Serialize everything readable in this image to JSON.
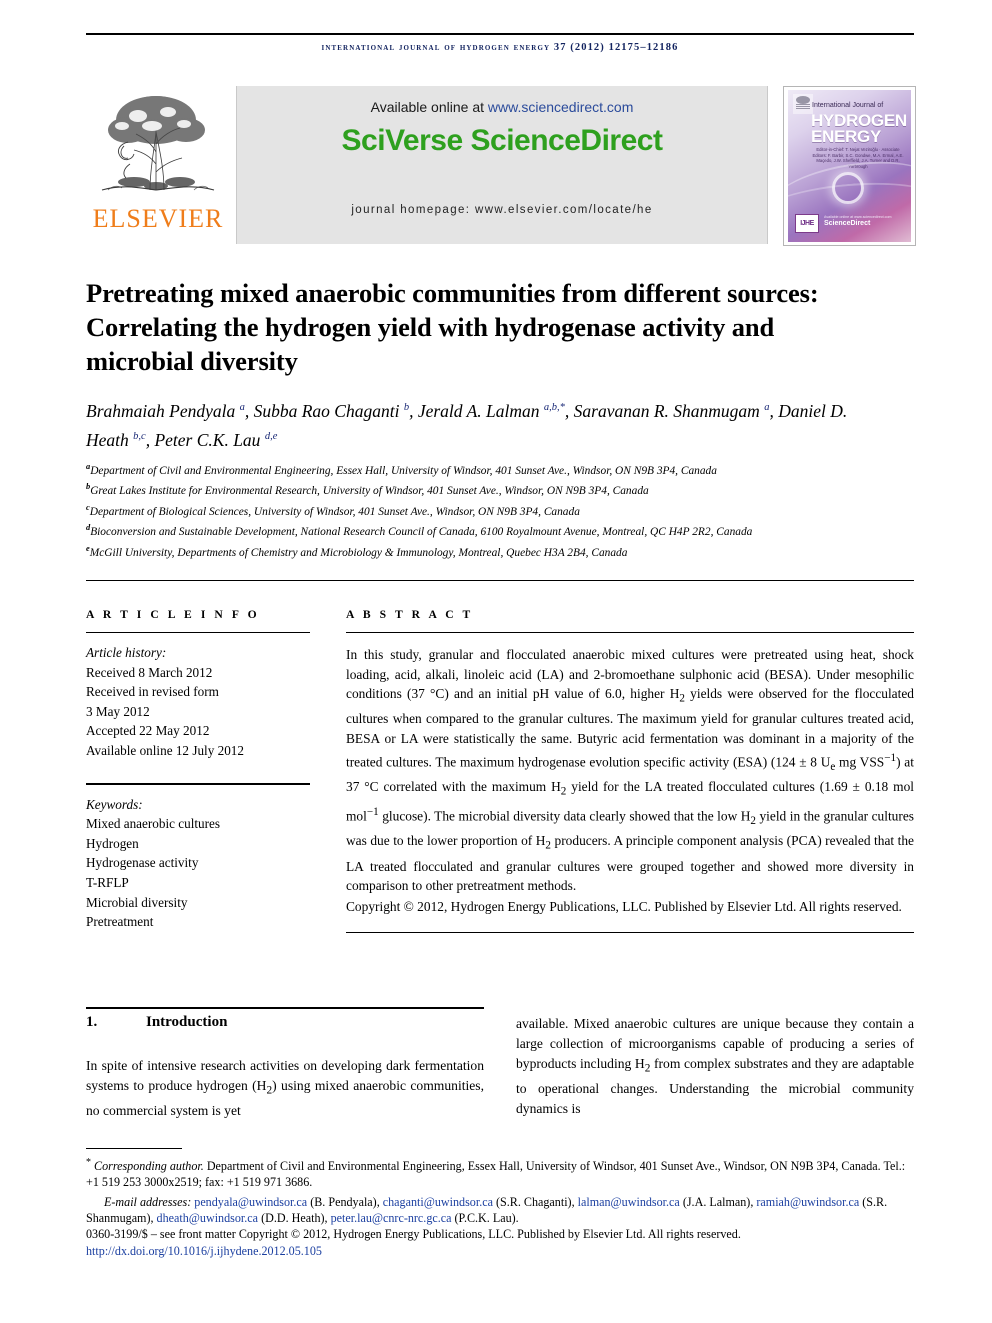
{
  "running_head": "international journal of hydrogen energy 37 (2012) 12175–12186",
  "masthead": {
    "publisher_name": "ELSEVIER",
    "available_prefix": "Available online at ",
    "available_link": "www.sciencedirect.com",
    "sciencedirect_logo": "SciVerse ScienceDirect",
    "journal_homepage": "journal homepage: www.elsevier.com/locate/he",
    "cover": {
      "line1": "International Journal of",
      "line2": "HYDROGEN",
      "line3": "ENERGY",
      "editors": "Editor-in-Chief: T. Nejat Veziroğlu · Associate Editors: F. Barbir, S.C. Gondwe, M.A. Ermal, A.E. Maçedo, J.W. Sheffield, J.A. Turner and D.R. Yarbrough",
      "badge": "IJHE",
      "sciencedirect_mark": "ScienceDirect",
      "sciencedirect_mark_top": "Available online at www.sciencedirect.com"
    }
  },
  "title": "Pretreating mixed anaerobic communities from different sources: Correlating the hydrogen yield with hydrogenase activity and microbial diversity",
  "authors_html": "Brahmaiah Pendyala <sup>a</sup>, Subba Rao Chaganti <sup>b</sup>, Jerald A. Lalman <sup>a,b,*</sup>, Saravanan R. Shanmugam <sup>a</sup>, Daniel D. Heath <sup>b,c</sup>, Peter C.K. Lau <sup>d,e</sup>",
  "affiliations": [
    {
      "mark": "a",
      "text": "Department of Civil and Environmental Engineering, Essex Hall, University of Windsor, 401 Sunset Ave., Windsor, ON N9B 3P4, Canada"
    },
    {
      "mark": "b",
      "text": "Great Lakes Institute for Environmental Research, University of Windsor, 401 Sunset Ave., Windsor, ON N9B 3P4, Canada"
    },
    {
      "mark": "c",
      "text": "Department of Biological Sciences, University of Windsor, 401 Sunset Ave., Windsor, ON N9B 3P4, Canada"
    },
    {
      "mark": "d",
      "text": "Bioconversion and Sustainable Development, National Research Council of Canada, 6100 Royalmount Avenue, Montreal, QC H4P 2R2, Canada"
    },
    {
      "mark": "e",
      "text": "McGill University, Departments of Chemistry and Microbiology & Immunology, Montreal, Quebec H3A 2B4, Canada"
    }
  ],
  "article_info": {
    "heading": "A R T I C L E   I N F O",
    "history_label": "Article history:",
    "history": [
      "Received 8 March 2012",
      "Received in revised form",
      "3 May 2012",
      "Accepted 22 May 2012",
      "Available online 12 July 2012"
    ],
    "keywords_label": "Keywords:",
    "keywords": [
      "Mixed anaerobic cultures",
      "Hydrogen",
      "Hydrogenase activity",
      "T-RFLP",
      "Microbial diversity",
      "Pretreatment"
    ]
  },
  "abstract": {
    "heading": "A B S T R A C T",
    "body_html": "In this study, granular and flocculated anaerobic mixed cultures were pretreated using heat, shock loading, acid, alkali, linoleic acid (LA) and 2-bromoethane sulphonic acid (BESA). Under mesophilic conditions (37&nbsp;&deg;C) and an initial pH value of 6.0, higher H<sub>2</sub> yields were observed for the flocculated cultures when compared to the granular cultures. The maximum yield for granular cultures treated acid, BESA or LA were statistically the same. Butyric acid fermentation was dominant in a majority of the treated cultures. The maximum hydrogenase evolution specific activity (ESA) (124&nbsp;&plusmn;&nbsp;8 U<sub>e</sub> mg VSS<sup>&minus;1</sup>) at 37&nbsp;&deg;C correlated with the maximum H<sub>2</sub> yield for the LA treated flocculated cultures (1.69&nbsp;&plusmn;&nbsp;0.18 mol mol<sup>&minus;1</sup> glucose). The microbial diversity data clearly showed that the low H<sub>2</sub> yield in the granular cultures was due to the lower proportion of H<sub>2</sub> producers. A principle component analysis (PCA) revealed that the LA treated flocculated and granular cultures were grouped together and showed more diversity in comparison to other pretreatment methods.",
    "copyright": "Copyright © 2012, Hydrogen Energy Publications, LLC. Published by Elsevier Ltd. All rights reserved."
  },
  "introduction": {
    "number": "1.",
    "title": "Introduction",
    "col_left_html": "In spite of intensive research activities on developing dark fermentation systems to produce hydrogen (H<sub>2</sub>) using mixed anaerobic communities, no commercial system is yet",
    "col_right_html": "available. Mixed anaerobic cultures are unique because they contain a large collection of microorganisms capable of producing a series of byproducts including H<sub>2</sub> from complex substrates and they are adaptable to operational changes. Understanding the microbial community dynamics is"
  },
  "footnotes": {
    "corresponding_html": "<span class=\"star\">*</span> <em>Corresponding author.</em> Department of Civil and Environmental Engineering, Essex Hall, University of Windsor, 401 Sunset Ave., Windsor, ON N9B 3P4, Canada. Tel.: +1 519 253 3000x2519; fax: +1 519 971 3686.",
    "email_label": "E-mail addresses:",
    "emails": [
      {
        "address": "pendyala@uwindsor.ca",
        "name": "(B. Pendyala)"
      },
      {
        "address": "chaganti@uwindsor.ca",
        "name": "(S.R. Chaganti)"
      },
      {
        "address": "lalman@uwindsor.ca",
        "name": "(J.A. Lalman)"
      },
      {
        "address": "ramiah@uwindsor.ca",
        "name": "(S.R. Shanmugam)"
      },
      {
        "address": "dheath@uwindsor.ca",
        "name": "(D.D. Heath)"
      },
      {
        "address": "peter.lau@cnrc-nrc.gc.ca",
        "name": "(P.C.K. Lau)"
      }
    ],
    "issn_line": "0360-3199/$ – see front matter Copyright © 2012, Hydrogen Energy Publications, LLC. Published by Elsevier Ltd. All rights reserved.",
    "doi": "http://dx.doi.org/10.1016/j.ijhydene.2012.05.105"
  },
  "colors": {
    "runhead": "#12235f",
    "elsevier_orange": "#ef7d1a",
    "sciencedirect_green": "#2ea01e",
    "link_blue": "#1b3fa0",
    "banner_gray": "#e4e4e4"
  }
}
